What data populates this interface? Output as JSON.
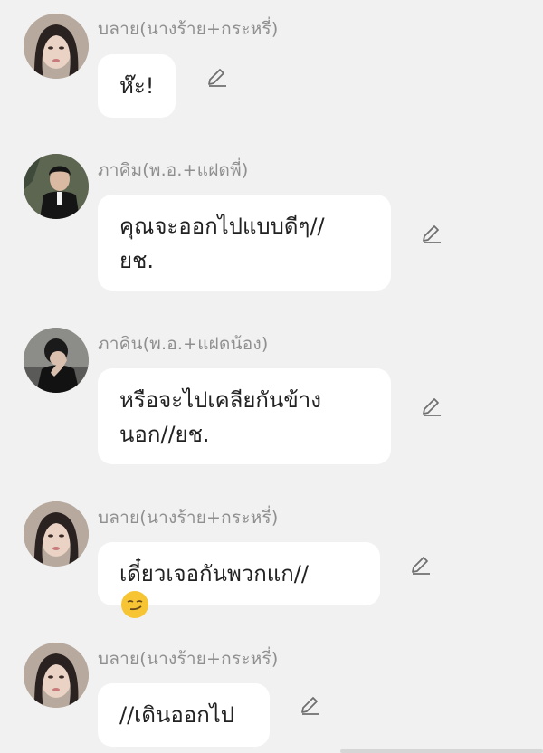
{
  "messages": [
    {
      "sender": "บลาย(นางร้าย+กระหรี่)",
      "avatar": "avatar-woman-photo",
      "lines": [
        "ห๊ะ!"
      ],
      "edit_icon": "pencil-icon"
    },
    {
      "sender": "ภาคิม(พ.อ.+แฝดพี่)",
      "avatar": "avatar-man-photo",
      "lines": [
        "คุณจะออกไปแบบดีๆ//",
        "ยช."
      ],
      "edit_icon": "pencil-icon"
    },
    {
      "sender": "ภาคิน(พ.อ.+แฝดน้อง)",
      "avatar": "avatar-man-covering-face-photo",
      "lines": [
        "หรือจะไปเคลียกันข้าง",
        "นอก//ยช."
      ],
      "edit_icon": "pencil-icon"
    },
    {
      "sender": "บลาย(นางร้าย+กระหรี่)",
      "avatar": "avatar-woman-photo",
      "lines": [
        "เดี๋ยวเจอกันพวกแก//"
      ],
      "emoji": "smirking-face-emoji",
      "edit_icon": "pencil-icon"
    },
    {
      "sender": "บลาย(นางร้าย+กระหรี่)",
      "avatar": "avatar-woman-photo",
      "lines": [
        "//เดินออกไป"
      ],
      "edit_icon": "pencil-icon"
    }
  ],
  "colors": {
    "background": "#f1f1f1",
    "bubble": "#ffffff",
    "sender_name": "#8f8f8f",
    "text": "#222222"
  }
}
